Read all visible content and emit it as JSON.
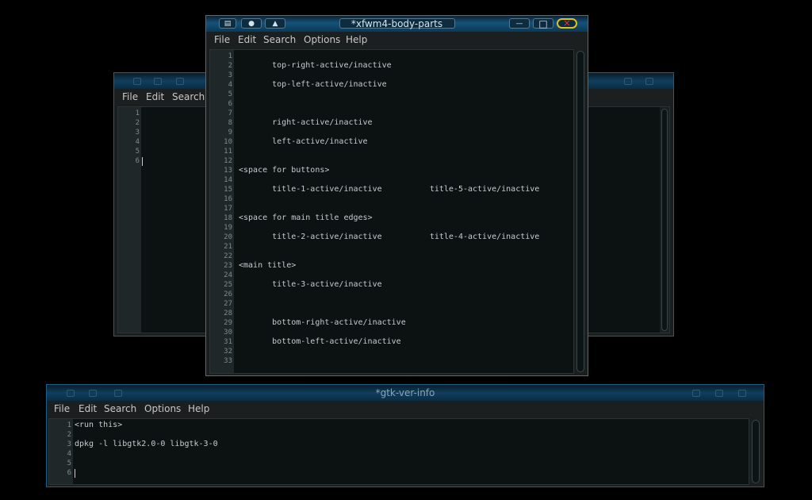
{
  "windows": {
    "back_left": {
      "menu": [
        "File",
        "Edit",
        "Search"
      ],
      "line_numbers": [
        "1",
        "2",
        "3",
        "4",
        "5",
        "6"
      ]
    },
    "main": {
      "title": "*xfwm4-body-parts",
      "menu": [
        "File",
        "Edit",
        "Search",
        "Options",
        "Help"
      ],
      "line_numbers": [
        "1",
        "2",
        "3",
        "4",
        "5",
        "6",
        "7",
        "8",
        "9",
        "10",
        "11",
        "12",
        "13",
        "14",
        "15",
        "16",
        "17",
        "18",
        "19",
        "20",
        "21",
        "22",
        "23",
        "24",
        "25",
        "26",
        "27",
        "28",
        "29",
        "30",
        "31",
        "32",
        "33"
      ],
      "lines": [
        "",
        "       top-right-active/inactive",
        "",
        "       top-left-active/inactive",
        "",
        "",
        "",
        "       right-active/inactive",
        "",
        "       left-active/inactive",
        "",
        "",
        "<space for buttons>",
        "",
        "       title-1-active/inactive          title-5-active/inactive",
        "",
        "",
        "<space for main title edges>",
        "",
        "       title-2-active/inactive          title-4-active/inactive",
        "",
        "",
        "<main title>",
        "",
        "       title-3-active/inactive",
        "",
        "",
        "",
        "       bottom-right-active/inactive",
        "",
        "       bottom-left-active/inactive",
        "",
        ""
      ],
      "buttons": {
        "menu_glyph": "▤",
        "stick_glyph": "●",
        "shade_glyph": "▲",
        "minimize_glyph": "—",
        "maximize_glyph": "□",
        "close_glyph": "✕"
      },
      "colors": {
        "close_ring": "#e0c020",
        "close_x": "#e03030"
      }
    },
    "bottom": {
      "title": "*gtk-ver-info",
      "menu": [
        "File",
        "Edit",
        "Search",
        "Options",
        "Help"
      ],
      "line_numbers": [
        "1",
        "2",
        "3",
        "4",
        "5",
        "6"
      ],
      "lines": [
        "<run this>",
        "",
        "dpkg -l libgtk2.0-0 libgtk-3-0",
        "",
        "",
        ""
      ]
    }
  }
}
